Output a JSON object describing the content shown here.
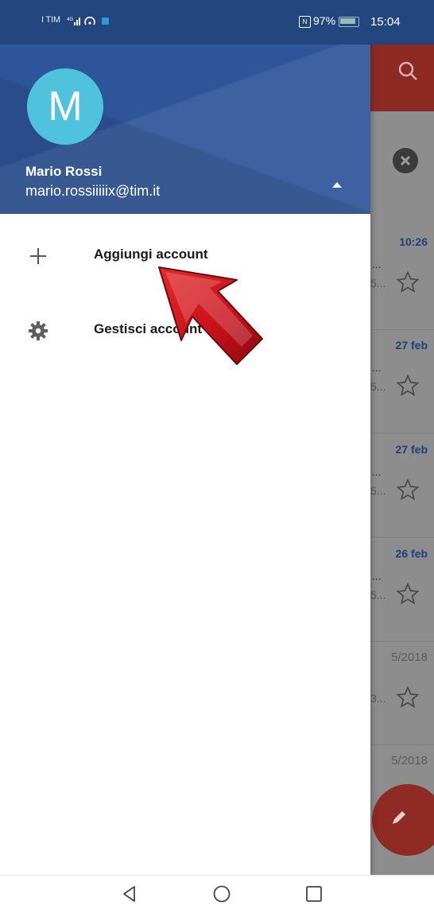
{
  "status_bar": {
    "carrier": "I TIM",
    "network": "4G",
    "battery": "97%",
    "time": "15:04"
  },
  "drawer": {
    "avatar_letter": "M",
    "account_name": "Mario Rossi",
    "account_email": "mario.rossiiiiix@tim.it",
    "menu": [
      {
        "label": "Aggiungi account",
        "icon": "plus-icon"
      },
      {
        "label": "Gestisci account",
        "icon": "gear-icon"
      }
    ]
  },
  "background_list": {
    "rows": [
      {
        "date": "10:26",
        "dots": "...",
        "snippet": "5..."
      },
      {
        "date": "27 feb",
        "dots": "...",
        "snippet": "5..."
      },
      {
        "date": "27 feb",
        "dots": "...",
        "snippet": "5..."
      },
      {
        "date": "26 feb",
        "dots": "...",
        "snippet": "5..."
      },
      {
        "date": "5/2018",
        "dots": "",
        "snippet": "3..."
      },
      {
        "date": "5/2018",
        "dots": "",
        "snippet": ""
      }
    ]
  },
  "colors": {
    "header_blue": "#2e5599",
    "status_blue": "#23467e",
    "avatar_cyan": "#4fc3dd",
    "toolbar_red": "#8e2a24",
    "arrow_red": "#c8101a"
  }
}
